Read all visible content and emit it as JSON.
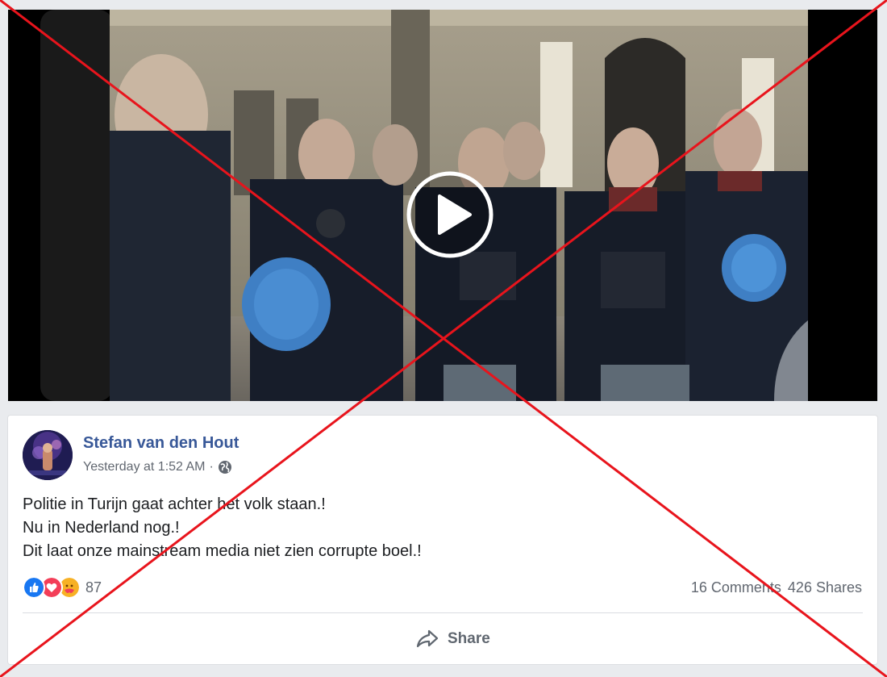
{
  "video": {
    "state": "paused",
    "play_icon": "play-icon"
  },
  "post": {
    "author": "Stefan van den Hout",
    "timestamp": "Yesterday at 1:52 AM",
    "separator": "·",
    "privacy_icon": "globe-icon",
    "text_lines": [
      "Politie in Turijn gaat achter het volk staan.!",
      "Nu in Nederland nog.!",
      "Dit laat onze mainstream media niet zien corrupte boel.!"
    ],
    "reactions": {
      "icons": [
        "like-icon",
        "love-icon",
        "care-icon"
      ],
      "count": "87"
    },
    "comments": "16 Comments",
    "shares": "426 Shares",
    "actions": {
      "share_label": "Share",
      "share_icon": "share-icon"
    }
  },
  "overlay": {
    "type": "red-cross",
    "color": "#e8141c"
  },
  "colors": {
    "page_bg": "#e9ebee",
    "author_blue": "#385898",
    "meta_gray": "#616770",
    "like_blue": "#1877f2",
    "love_red": "#f33e58",
    "care_yellow": "#f7b125"
  }
}
